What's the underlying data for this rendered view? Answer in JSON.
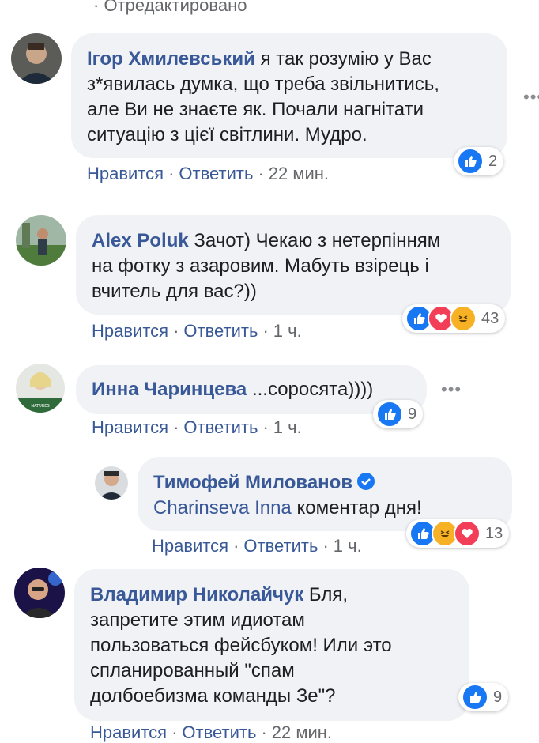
{
  "top": {
    "edited_label": "· Отредактировано"
  },
  "colors": {
    "link": "#385898",
    "bubble_bg": "#f0f2f5",
    "meta": "#65676b",
    "like": "#1877f2",
    "love": "#f33e58",
    "haha": "#f7b125"
  },
  "comments": [
    {
      "author": "Ігор Хмилевський",
      "text_lines": [
        "я так розумію у Вас",
        "з*явилась думка, що треба звільнитись,",
        "але Ви не знаєте як. Почали нагнітати",
        "ситуацію з цієї світлини. Мудро."
      ],
      "like": "Нравится",
      "reply": "Ответить",
      "time": "22 мин.",
      "reactions": [
        "like-icon"
      ],
      "reaction_count": "2"
    },
    {
      "author": "Alex Poluk",
      "text_lines": [
        "Зачот) Чекаю з нетерпінням",
        "на фотку з азаровим. Мабуть взірець і",
        "вчитель для вас?))"
      ],
      "like": "Нравится",
      "reply": "Ответить",
      "time": "1 ч.",
      "reactions": [
        "like-icon",
        "love-icon",
        "haha-icon"
      ],
      "reaction_count": "43"
    },
    {
      "author": "Инна Чаринцева",
      "text_lines": [
        "...соросята))))"
      ],
      "like": "Нравится",
      "reply": "Ответить",
      "time": "1 ч.",
      "reactions": [
        "like-icon"
      ],
      "reaction_count": "9"
    },
    {
      "author": "Тимофей Милованов",
      "mention": "Charinseva Inna",
      "text_lines": [
        "коментар дня!"
      ],
      "like": "Нравится",
      "reply": "Ответить",
      "time": "1 ч.",
      "reactions": [
        "like-icon",
        "haha-icon",
        "love-icon"
      ],
      "reaction_count": "13"
    },
    {
      "author": "Владимир Николайчук",
      "text_lines": [
        "Бля,",
        "запретите этим идиотам",
        "пользоваться фейсбуком! Или это",
        "спланированный \"спам",
        "долбоебизма команды Зе\"?"
      ],
      "like": "Нравится",
      "reply": "Ответить",
      "time": "22 мин.",
      "reactions": [
        "like-icon"
      ],
      "reaction_count": "9"
    }
  ]
}
